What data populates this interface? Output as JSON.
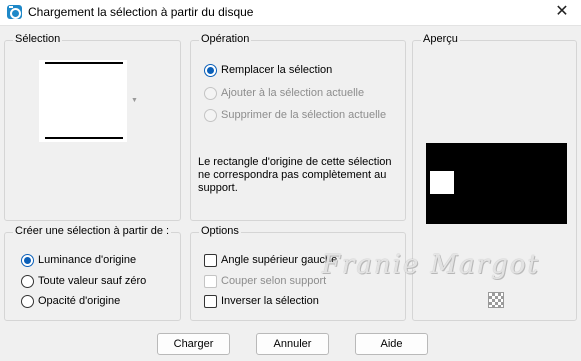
{
  "window": {
    "title": "Chargement la sélection à partir du disque",
    "close_glyph": "✕"
  },
  "selection_group": {
    "label": "Sélection"
  },
  "operation_group": {
    "label": "Opération",
    "options": [
      {
        "label": "Remplacer la sélection",
        "checked": true,
        "enabled": true
      },
      {
        "label": "Ajouter à la sélection actuelle",
        "checked": false,
        "enabled": false
      },
      {
        "label": "Supprimer de la sélection actuelle",
        "checked": false,
        "enabled": false
      }
    ],
    "message": "Le rectangle d'origine de cette sélection ne correspondra pas complètement au support."
  },
  "apercu_group": {
    "label": "Aperçu"
  },
  "create_group": {
    "label": "Créer une sélection à partir de :",
    "options": [
      {
        "label": "Luminance d'origine",
        "checked": true
      },
      {
        "label": "Toute valeur sauf zéro",
        "checked": false
      },
      {
        "label": "Opacité d'origine",
        "checked": false
      }
    ]
  },
  "options_group": {
    "label": "Options",
    "items": [
      {
        "label": "Angle supérieur gauche",
        "checked": false,
        "enabled": true
      },
      {
        "label": "Couper selon support",
        "checked": false,
        "enabled": false
      },
      {
        "label": "Inverser la sélection",
        "checked": false,
        "enabled": true
      }
    ]
  },
  "watermark": "Franie Margot",
  "buttons": {
    "load": "Charger",
    "cancel": "Annuler",
    "help": "Aide"
  }
}
